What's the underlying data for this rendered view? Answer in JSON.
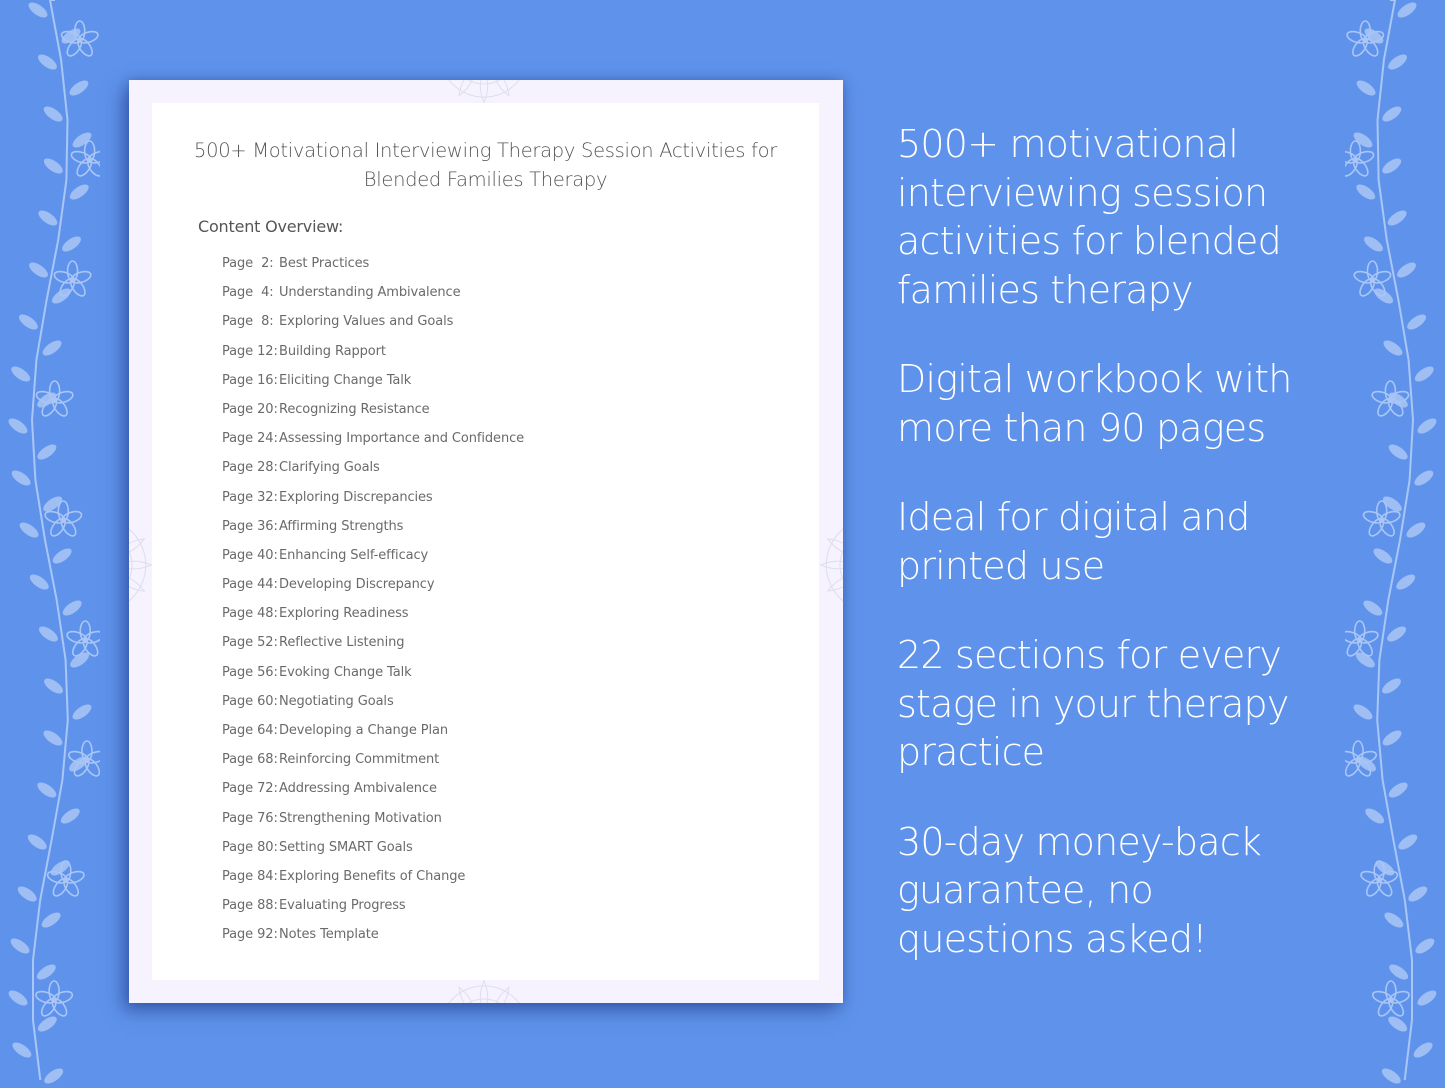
{
  "document": {
    "title_line1": "500+ Motivational Interviewing Therapy Session Activities for",
    "title_line2": "Blended Families Therapy",
    "overview_label": "Content Overview:",
    "toc": [
      {
        "page": "Page  2:",
        "label": "Best Practices"
      },
      {
        "page": "Page  4:",
        "label": "Understanding Ambivalence"
      },
      {
        "page": "Page  8:",
        "label": "Exploring Values and Goals"
      },
      {
        "page": "Page 12:",
        "label": "Building Rapport"
      },
      {
        "page": "Page 16:",
        "label": "Eliciting Change Talk"
      },
      {
        "page": "Page 20:",
        "label": "Recognizing Resistance"
      },
      {
        "page": "Page 24:",
        "label": "Assessing Importance and Confidence"
      },
      {
        "page": "Page 28:",
        "label": "Clarifying Goals"
      },
      {
        "page": "Page 32:",
        "label": "Exploring Discrepancies"
      },
      {
        "page": "Page 36:",
        "label": "Affirming Strengths"
      },
      {
        "page": "Page 40:",
        "label": "Enhancing Self-efficacy"
      },
      {
        "page": "Page 44:",
        "label": "Developing Discrepancy"
      },
      {
        "page": "Page 48:",
        "label": "Exploring Readiness"
      },
      {
        "page": "Page 52:",
        "label": "Reflective Listening"
      },
      {
        "page": "Page 56:",
        "label": "Evoking Change Talk"
      },
      {
        "page": "Page 60:",
        "label": "Negotiating Goals"
      },
      {
        "page": "Page 64:",
        "label": "Developing a Change Plan"
      },
      {
        "page": "Page 68:",
        "label": "Reinforcing Commitment"
      },
      {
        "page": "Page 72:",
        "label": "Addressing Ambivalence"
      },
      {
        "page": "Page 76:",
        "label": "Strengthening Motivation"
      },
      {
        "page": "Page 80:",
        "label": "Setting SMART Goals"
      },
      {
        "page": "Page 84:",
        "label": "Exploring Benefits of Change"
      },
      {
        "page": "Page 88:",
        "label": "Evaluating Progress"
      },
      {
        "page": "Page 92:",
        "label": "Notes Template"
      }
    ]
  },
  "features": [
    [
      "500+ motivational",
      "interviewing session",
      "activities for blended",
      "families therapy"
    ],
    [
      "Digital workbook with",
      "more than 90 pages"
    ],
    [
      "Ideal for digital and",
      "printed use"
    ],
    [
      "22 sections for every",
      "stage in your therapy",
      "practice"
    ],
    [
      "30-day money-back",
      "guarantee, no",
      "questions asked!"
    ]
  ],
  "colors": {
    "background": "#5f93eb",
    "page_border": "#f6f3fe",
    "page": "#ffffff",
    "doc_text": "#555555",
    "feature_text": "#ffffff",
    "vine": "#a9c6f6"
  },
  "icons": {
    "left_decoration": "floral-vine-icon",
    "right_decoration": "floral-vine-icon",
    "page_ornament": "mandala-icon"
  }
}
